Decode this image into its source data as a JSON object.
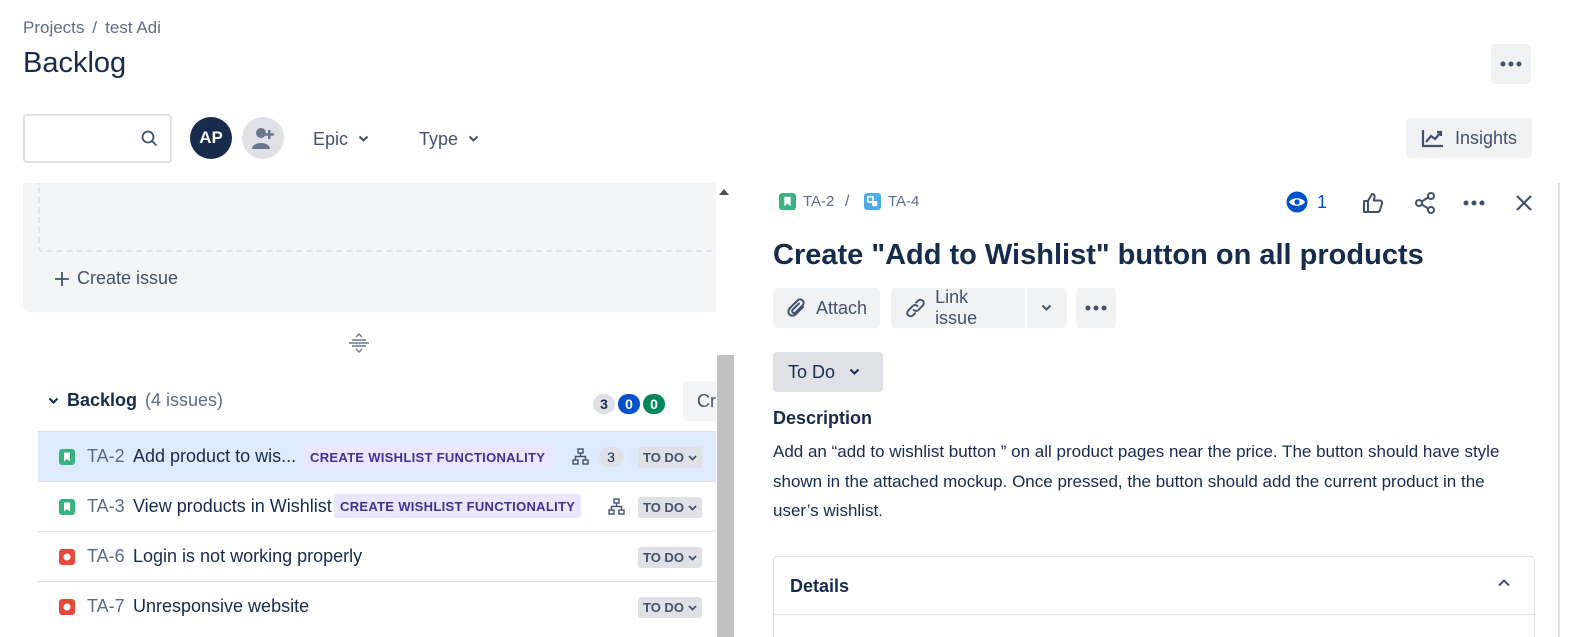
{
  "header": {
    "breadcrumb": [
      "Projects",
      "test Adi"
    ],
    "breadcrumb_sep": "/",
    "title": "Backlog"
  },
  "filters": {
    "search_placeholder": "",
    "avatar_initials": "AP",
    "epic_label": "Epic",
    "type_label": "Type",
    "insights_label": "Insights"
  },
  "sprint": {
    "create_issue_label": "Create issue"
  },
  "backlog": {
    "name": "Backlog",
    "count_label": "(4 issues)",
    "counters": {
      "todo": "3",
      "in_progress": "0",
      "done": "0"
    },
    "create_sprint_label": "Create sprint",
    "issues": [
      {
        "key": "TA-2",
        "summary": "Add product to wis...",
        "epic": "CREATE WISHLIST FUNCTIONALITY",
        "type": "story",
        "child_count": "3",
        "status": "TO DO",
        "selected": true
      },
      {
        "key": "TA-3",
        "summary": "View products in Wishlist",
        "epic": "CREATE WISHLIST FUNCTIONALITY",
        "type": "story",
        "child_count": "",
        "status": "TO DO",
        "selected": false
      },
      {
        "key": "TA-6",
        "summary": "Login is not working properly",
        "epic": "",
        "type": "bug",
        "child_count": "",
        "status": "TO DO",
        "selected": false
      },
      {
        "key": "TA-7",
        "summary": "Unresponsive website",
        "epic": "",
        "type": "bug",
        "child_count": "",
        "status": "TO DO",
        "selected": false
      }
    ]
  },
  "detail": {
    "parent_key": "TA-2",
    "issue_key": "TA-4",
    "watch_count": "1",
    "title": "Create \"Add to Wishlist\" button on all products",
    "attach_label": "Attach",
    "link_issue_label": "Link issue",
    "status_label": "To Do",
    "description_label": "Description",
    "description_text": "Add an “add to wishlist button ” on all product pages near the price. The button should have style shown in the attached mockup. Once pressed, the button should add the current product in the user’s wishlist.",
    "details_label": "Details"
  },
  "colors": {
    "story": "#36b37e",
    "bug": "#e5493a",
    "subtask": "#4bade8",
    "primary_text": "#172b4d",
    "brand_blue": "#0052cc"
  }
}
